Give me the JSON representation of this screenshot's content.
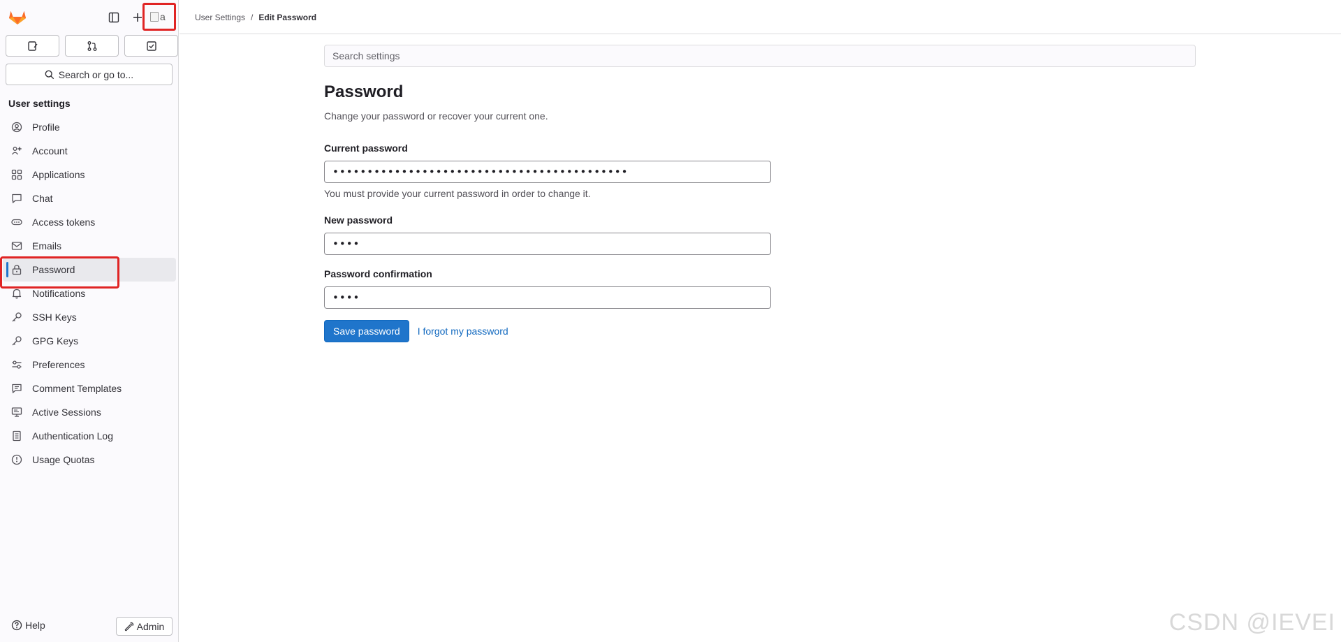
{
  "header": {
    "breadcrumb": {
      "parent": "User Settings",
      "separator": "/",
      "current": "Edit Password"
    }
  },
  "sidebar": {
    "logo_icon": "gitlab-tanuki-icon",
    "top_icons": [
      "sidebar-toggle-icon",
      "plus-icon"
    ],
    "avatar_alt": "a",
    "quick_actions": [
      "issues-icon",
      "merge-requests-icon",
      "todos-icon"
    ],
    "search_label": "Search or go to...",
    "section_title": "User settings",
    "items": [
      {
        "label": "Profile",
        "icon": "profile-icon"
      },
      {
        "label": "Account",
        "icon": "account-icon"
      },
      {
        "label": "Applications",
        "icon": "applications-icon"
      },
      {
        "label": "Chat",
        "icon": "chat-icon"
      },
      {
        "label": "Access tokens",
        "icon": "token-icon"
      },
      {
        "label": "Emails",
        "icon": "mail-icon"
      },
      {
        "label": "Password",
        "icon": "lock-icon",
        "active": true
      },
      {
        "label": "Notifications",
        "icon": "bell-icon"
      },
      {
        "label": "SSH Keys",
        "icon": "key-icon"
      },
      {
        "label": "GPG Keys",
        "icon": "key-icon"
      },
      {
        "label": "Preferences",
        "icon": "preferences-icon"
      },
      {
        "label": "Comment Templates",
        "icon": "comment-icon"
      },
      {
        "label": "Active Sessions",
        "icon": "monitor-icon"
      },
      {
        "label": "Authentication Log",
        "icon": "log-icon"
      },
      {
        "label": "Usage Quotas",
        "icon": "quota-icon"
      }
    ],
    "help_label": "Help",
    "admin_label": "Admin"
  },
  "main": {
    "search_placeholder": "Search settings",
    "title": "Password",
    "description": "Change your password or recover your current one.",
    "current_password": {
      "label": "Current password",
      "value": "•••••••••••••••••••••••••••••••••••••••••••",
      "help": "You must provide your current password in order to change it."
    },
    "new_password": {
      "label": "New password",
      "value": "••••"
    },
    "password_confirmation": {
      "label": "Password confirmation",
      "value": "••••"
    },
    "save_label": "Save password",
    "forgot_label": "I forgot my password"
  },
  "colors": {
    "primary": "#1f75cb",
    "link": "#1068bf",
    "highlight_border": "#e02424"
  },
  "watermark": "CSDN @IEVEI"
}
